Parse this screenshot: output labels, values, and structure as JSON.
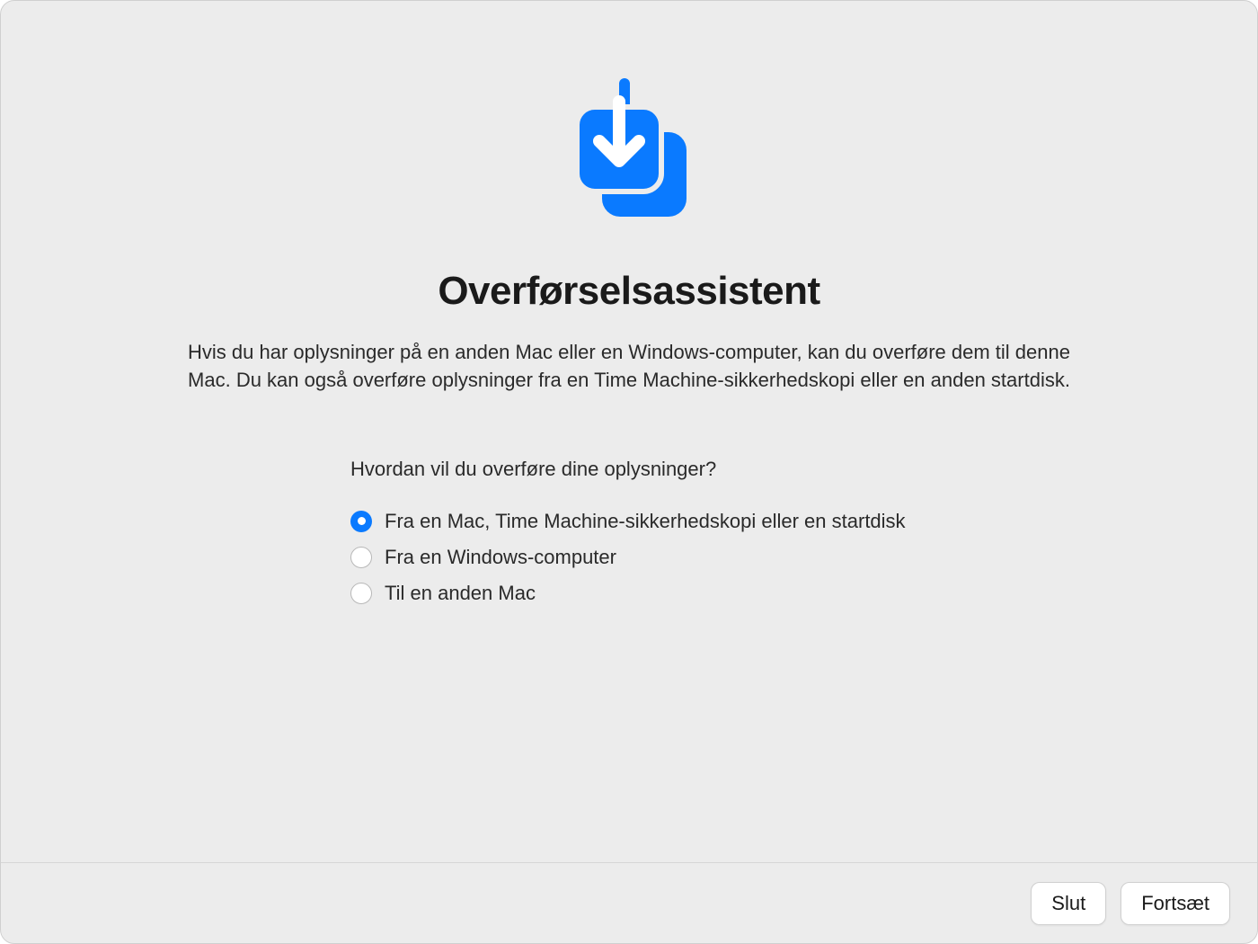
{
  "title": "Overførselsassistent",
  "description": "Hvis du har oplysninger på en anden Mac eller en Windows-computer, kan du overføre dem til denne Mac. Du kan også overføre oplysninger fra en Time Machine-sikkerhedskopi eller en anden startdisk.",
  "question": "Hvordan vil du overføre dine oplysninger?",
  "options": [
    {
      "label": "Fra en Mac, Time Machine-sikkerhedskopi eller en startdisk",
      "selected": true
    },
    {
      "label": "Fra en Windows-computer",
      "selected": false
    },
    {
      "label": "Til en anden Mac",
      "selected": false
    }
  ],
  "buttons": {
    "quit": "Slut",
    "continue": "Fortsæt"
  },
  "colors": {
    "accent": "#0a7aff",
    "background": "#ececec"
  }
}
